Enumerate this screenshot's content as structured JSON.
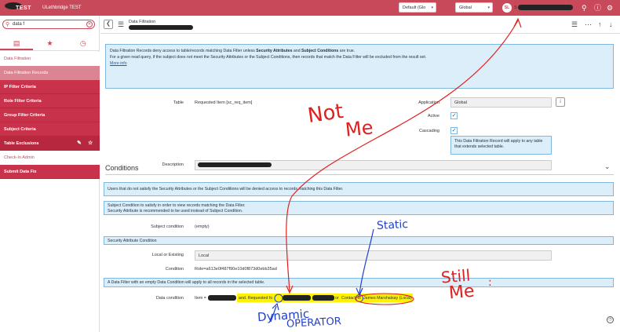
{
  "topbar": {
    "logo_text": "TEST",
    "instance_name": "ULethbridge TEST",
    "app_scope": "Default (Glo",
    "update_set": "Global",
    "avatar_initials": "SL",
    "user_name_prefix": "S"
  },
  "sidebar": {
    "filter_value": "data f",
    "tabs": [
      "all",
      "favorites",
      "history"
    ],
    "items": [
      {
        "label": "Data Filtration",
        "kind": "header"
      },
      {
        "label": "Data Filtration Records",
        "kind": "selected"
      },
      {
        "label": "IP Filter Criteria",
        "kind": "module"
      },
      {
        "label": "Role Filter Criteria",
        "kind": "module"
      },
      {
        "label": "Group Filter Criteria",
        "kind": "module"
      },
      {
        "label": "Subject Criteria",
        "kind": "module"
      },
      {
        "label": "Table Exclusions",
        "kind": "module"
      },
      {
        "label": "Check-In Admin",
        "kind": "header"
      },
      {
        "label": "Submit Data Fix",
        "kind": "module"
      }
    ]
  },
  "form": {
    "title": "Data Filtration",
    "info_line1_a": "Data Filtration Records deny access to table/records matching Data Filter unless ",
    "info_line1_b": "Security Attributes",
    "info_line1_c": " and ",
    "info_line1_d": "Subject Conditions",
    "info_line1_e": " are true.",
    "info_line2": "For a given read query, if the subject does not meet the Security Attributes or the Subject Conditions, then records that match the Data Filter will be excluded from the result set.",
    "more_info": "More info",
    "table_label": "Table",
    "table_value": "Requested Item [sc_req_item]",
    "application_label": "Application",
    "application_value": "Global",
    "active_label": "Active",
    "cascading_label": "Cascading",
    "cascading_note": "This Data Filtration Record will apply to any table that extends selected table.",
    "description_label": "Description",
    "conditions_title": "Conditions",
    "users_note": "Users that do not satisfy the Security Attributes or the Subject Conditions will be denied access to records matching this Data Filter.",
    "subject_note_1": "Subject Condition to satisfy in order to view records matching the Data Filter.",
    "subject_note_2": "Security Attribute is recommended to be used instead of Subject Condition.",
    "subject_condition_label": "Subject condition",
    "subject_condition_value": "(empty)",
    "security_attr_header": "Security Attribute Condition",
    "local_label": "Local or Existing",
    "local_value": "Local",
    "condition_label": "Condition",
    "condition_value": "Role=a613e0f487f90e10d0f873d0ebb35ad",
    "data_filter_note": "A Data Filter with an empty Data Condition will apply to all records in the selected table.",
    "data_condition_label": "Data condition",
    "dc_item": "Item =",
    "dc_and": "and. Requested fo",
    "dc_or": "or",
    "dc_contact": "Contact",
    "dc_is": "is",
    "dc_james": "James Marshalsay (Local)"
  },
  "annotations": {
    "not_me": [
      "Not",
      "Me"
    ],
    "static": "Static",
    "still_me": [
      "Still",
      "Me"
    ],
    "dynamic": [
      "Dynamic",
      "OPERATOR"
    ]
  },
  "colors": {
    "brand": "#c84a5a",
    "module": "#c8324a",
    "info_bg": "#dceef9",
    "highlight": "#fff200",
    "annotation_red": "#e0201e",
    "annotation_blue": "#1f3fcf"
  }
}
